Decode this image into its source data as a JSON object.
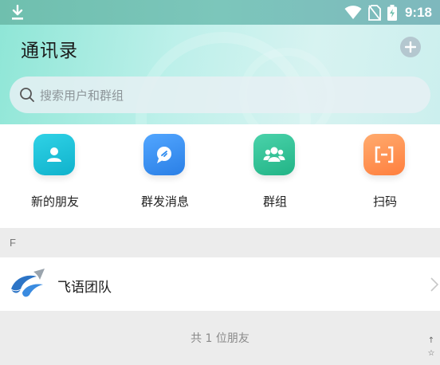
{
  "status_bar": {
    "time": "9:18",
    "icons": [
      "download-icon",
      "wifi-icon",
      "no-sim-icon",
      "battery-charging-icon"
    ]
  },
  "header": {
    "title": "通讯录",
    "add_icon": "plus-icon"
  },
  "search": {
    "placeholder": "搜索用户和群组",
    "icon": "search-icon"
  },
  "actions": [
    {
      "label": "新的朋友",
      "icon": "person-icon",
      "color": "#14c0d8"
    },
    {
      "label": "群发消息",
      "icon": "chat-bubble-icon",
      "color": "#2f8cf0"
    },
    {
      "label": "群组",
      "icon": "group-icon",
      "color": "#2fbf95"
    },
    {
      "label": "扫码",
      "icon": "scan-icon",
      "color": "#ff8e4c"
    }
  ],
  "contacts": {
    "section_letter": "F",
    "items": [
      {
        "name": "飞语团队",
        "icon": "bird-logo-icon"
      }
    ],
    "footer": "共 1 位朋友"
  },
  "scroll_index": [
    "↑",
    "☆"
  ]
}
